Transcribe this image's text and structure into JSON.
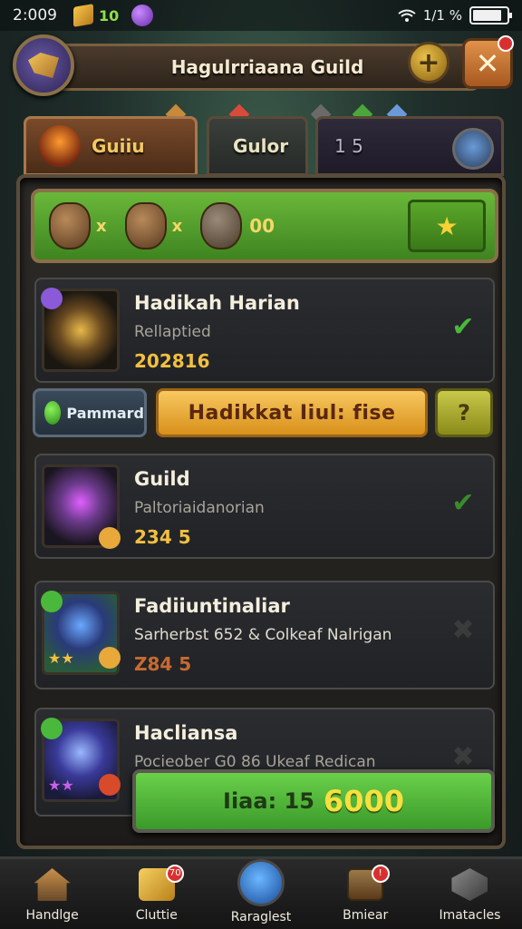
{
  "status_bar": {
    "time": "2:009",
    "gem_count": "10",
    "signal_text": "1/1 %",
    "icons": [
      "gold-cube-icon",
      "purple-orb-icon",
      "wifi-icon",
      "battery-icon"
    ]
  },
  "header": {
    "title": "Hagulrriaana Guild",
    "emblem_icon": "guild-emblem-icon",
    "add_icon": "+",
    "close_icon": "✕"
  },
  "tabs": [
    {
      "label": "Guiiu",
      "icon": "flame-icon",
      "active": true
    },
    {
      "label": "Gulor",
      "icon": "",
      "active": false
    },
    {
      "label": "1 5",
      "icon": "shield-icon",
      "active": false
    }
  ],
  "reward_bar": {
    "items": [
      "artifact-icon",
      "helmet-icon",
      "stone-icon"
    ],
    "separator": "x",
    "amount": "00",
    "button_icon": "★"
  },
  "quests": [
    {
      "title": "Hadikah Harian",
      "subtitle": "Rellaptied",
      "value": "202816",
      "status": "✔"
    },
    {
      "title": "Guild",
      "subtitle": "Paltoriaidanorian",
      "value": "234 5",
      "status": "✔"
    },
    {
      "title": "Fadiiuntinaliar",
      "subtitle": "Sarherbst 652 & Colkeaf Nalrigan",
      "value": "Z84 5",
      "status": "✖"
    },
    {
      "title": "Hacliansa",
      "subtitle": "Pocieober G0 86 Ukeaf Redican",
      "value": "",
      "status": "✖"
    }
  ],
  "actions": {
    "pammard_label": "Pammard",
    "claim_label": "Hadikkat Iiul: fise",
    "help_label": "?"
  },
  "total": {
    "label": "Iiaa: 15",
    "value": "6000"
  },
  "bottom_nav": [
    {
      "label": "Handlge",
      "icon": "house-icon",
      "badge": ""
    },
    {
      "label": "Cluttie",
      "icon": "gold-bar-icon",
      "badge": "70"
    },
    {
      "label": "Raraglest",
      "icon": "portal-orb-icon",
      "badge": ""
    },
    {
      "label": "Bmiear",
      "icon": "chest-icon",
      "badge": "!"
    },
    {
      "label": "Imatacles",
      "icon": "crystal-icon",
      "badge": ""
    }
  ],
  "colors": {
    "accent_green": "#6ab83a",
    "accent_gold": "#f2c040",
    "panel_border": "#5a4c3a"
  }
}
